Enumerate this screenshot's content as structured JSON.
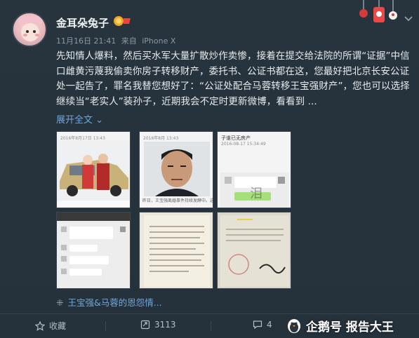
{
  "user": {
    "name": "金耳朵兔子",
    "date": "11月16日 21:41",
    "source_prefix": "来自",
    "device": "iPhone X"
  },
  "post": {
    "text": "先知情人爆料，然后买水军大量扩散炒作卖惨，接着在提交给法院的所谓“证据”中信口雌黄污蔑我偷卖你房子转移财产，委托书、公证书都在这，您最好把北京长安公证处一起告了，罪名我替您想好了：“公证处配合马蓉转移王宝强财产”，您也可以选择继续当“老实人”装孙子，近期我会不定时更新微博，看看到 ...",
    "expand_label": "展开全文",
    "expand_arrow": "⌄"
  },
  "images": [
    {
      "timestamp": "2016年8月17日 13:43",
      "caption": ""
    },
    {
      "timestamp": "2016年8月 13:43",
      "caption": "昨日，王宝强离婚事件持续发酵中。这两"
    },
    {
      "timestamp": "2016-08-17 15:34:49",
      "caption": "子谁已无房产"
    },
    {
      "timestamp": "",
      "caption": ""
    },
    {
      "timestamp": "",
      "caption": ""
    },
    {
      "timestamp": "",
      "caption": ""
    }
  ],
  "topic": {
    "icon": "⁜",
    "label": "王宝强&马蓉的恩怨情..."
  },
  "actions": {
    "favorite_label": "收藏",
    "repost_count": "3113",
    "comment_count": "4"
  },
  "watermark": {
    "text": "企鹅号 报告大王"
  },
  "colors": {
    "background": "#25313b",
    "link": "#6fa8dc",
    "text": "#e8ebee"
  }
}
